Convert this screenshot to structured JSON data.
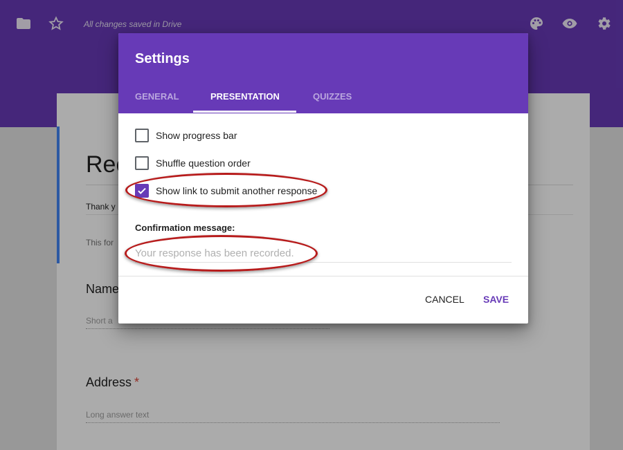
{
  "toolbar": {
    "saved_status": "All changes saved in Drive",
    "icons": [
      "folder-icon",
      "star-icon",
      "palette-icon",
      "eye-icon",
      "gear-icon"
    ]
  },
  "form": {
    "title": "Rec",
    "description": "Thank y",
    "note": "This for",
    "questions": [
      {
        "title": "Name",
        "required": false,
        "hint": "Short a"
      },
      {
        "title": "Address",
        "required": true,
        "required_mark": "*",
        "hint": "Long answer text"
      }
    ]
  },
  "dialog": {
    "title": "Settings",
    "tabs": [
      {
        "label": "GENERAL",
        "active": false
      },
      {
        "label": "PRESENTATION",
        "active": true
      },
      {
        "label": "QUIZZES",
        "active": false
      }
    ],
    "options": [
      {
        "label": "Show progress bar",
        "checked": false
      },
      {
        "label": "Shuffle question order",
        "checked": false
      },
      {
        "label": "Show link to submit another response",
        "checked": true
      }
    ],
    "confirmation_label": "Confirmation message:",
    "confirmation_value": "",
    "confirmation_placeholder": "Your response has been recorded.",
    "cancel_label": "CANCEL",
    "save_label": "SAVE"
  },
  "colors": {
    "brand": "#673ab7",
    "accent_blue": "#4285f4",
    "required_red": "#db4437",
    "highlight_red": "#b71c1c"
  }
}
